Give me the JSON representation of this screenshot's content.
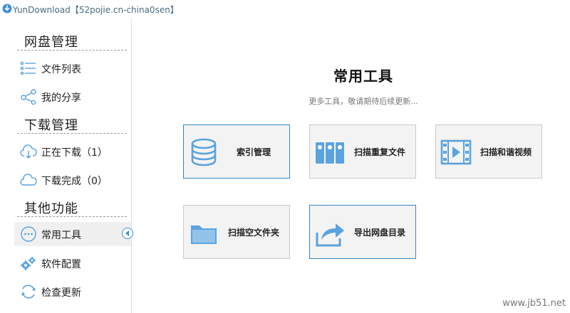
{
  "window": {
    "title": "YunDownload【52pojie.cn-china0sen】"
  },
  "sidebar": {
    "sections": [
      {
        "title": "网盘管理"
      },
      {
        "title": "下载管理"
      },
      {
        "title": "其他功能"
      }
    ],
    "items": [
      {
        "label": "文件列表",
        "icon": "list-icon"
      },
      {
        "label": "我的分享",
        "icon": "share-icon"
      },
      {
        "label": "正在下载（1）",
        "icon": "cloud-download-icon"
      },
      {
        "label": "下载完成（0）",
        "icon": "cloud-done-icon"
      },
      {
        "label": "常用工具",
        "icon": "more-tools-icon",
        "active": true
      },
      {
        "label": "软件配置",
        "icon": "gears-icon"
      },
      {
        "label": "检查更新",
        "icon": "refresh-icon"
      }
    ]
  },
  "main": {
    "title": "常用工具",
    "subtitle": "更多工具，敬请期待后续更新...",
    "tools": [
      {
        "label": "索引管理",
        "icon": "database-icon"
      },
      {
        "label": "扫描重复文件",
        "icon": "binders-icon"
      },
      {
        "label": "扫描和谐视频",
        "icon": "film-icon"
      },
      {
        "label": "扫描空文件夹",
        "icon": "folder-icon"
      },
      {
        "label": "导出网盘目录",
        "icon": "export-arrow-icon"
      }
    ]
  },
  "watermark": "www.jb51.net",
  "colors": {
    "accent": "#3d8fd8",
    "icon_blue": "#5aa3de",
    "card_bg": "#f3f3f3"
  }
}
